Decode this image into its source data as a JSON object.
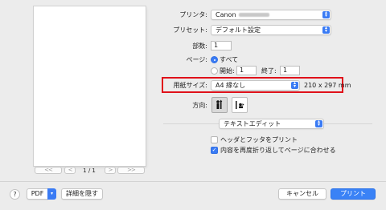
{
  "preview": {
    "page_indicator": "1 / 1",
    "nav_first": "<<",
    "nav_prev": "<",
    "nav_next": ">",
    "nav_last": ">>"
  },
  "printer": {
    "label": "プリンタ:",
    "value": "Canon"
  },
  "preset": {
    "label": "プリセット:",
    "value": "デフォルト設定"
  },
  "copies": {
    "label": "部数:",
    "value": "1"
  },
  "pages": {
    "label": "ページ:",
    "all_label": "すべて",
    "all_selected": true,
    "from_label": "開始:",
    "from_value": "1",
    "to_label": "終了:",
    "to_value": "1"
  },
  "paper_size": {
    "label": "用紙サイズ:",
    "value": "A4 縁なし",
    "dimensions": "210 x 297 mm"
  },
  "orientation": {
    "label": "方向:",
    "selected": "portrait"
  },
  "app_section": {
    "value": "テキストエディット"
  },
  "options": {
    "header_footer_label": "ヘッダとフッタをプリント",
    "header_footer_checked": false,
    "rewrap_label": "内容を再度折り返してページに合わせる",
    "rewrap_checked": true
  },
  "footer": {
    "help": "?",
    "pdf_label": "PDF",
    "hide_details_label": "詳細を隠す",
    "cancel_label": "キャンセル",
    "print_label": "プリント"
  },
  "colors": {
    "accent": "#3a7bf4",
    "highlight": "#e0111a"
  }
}
